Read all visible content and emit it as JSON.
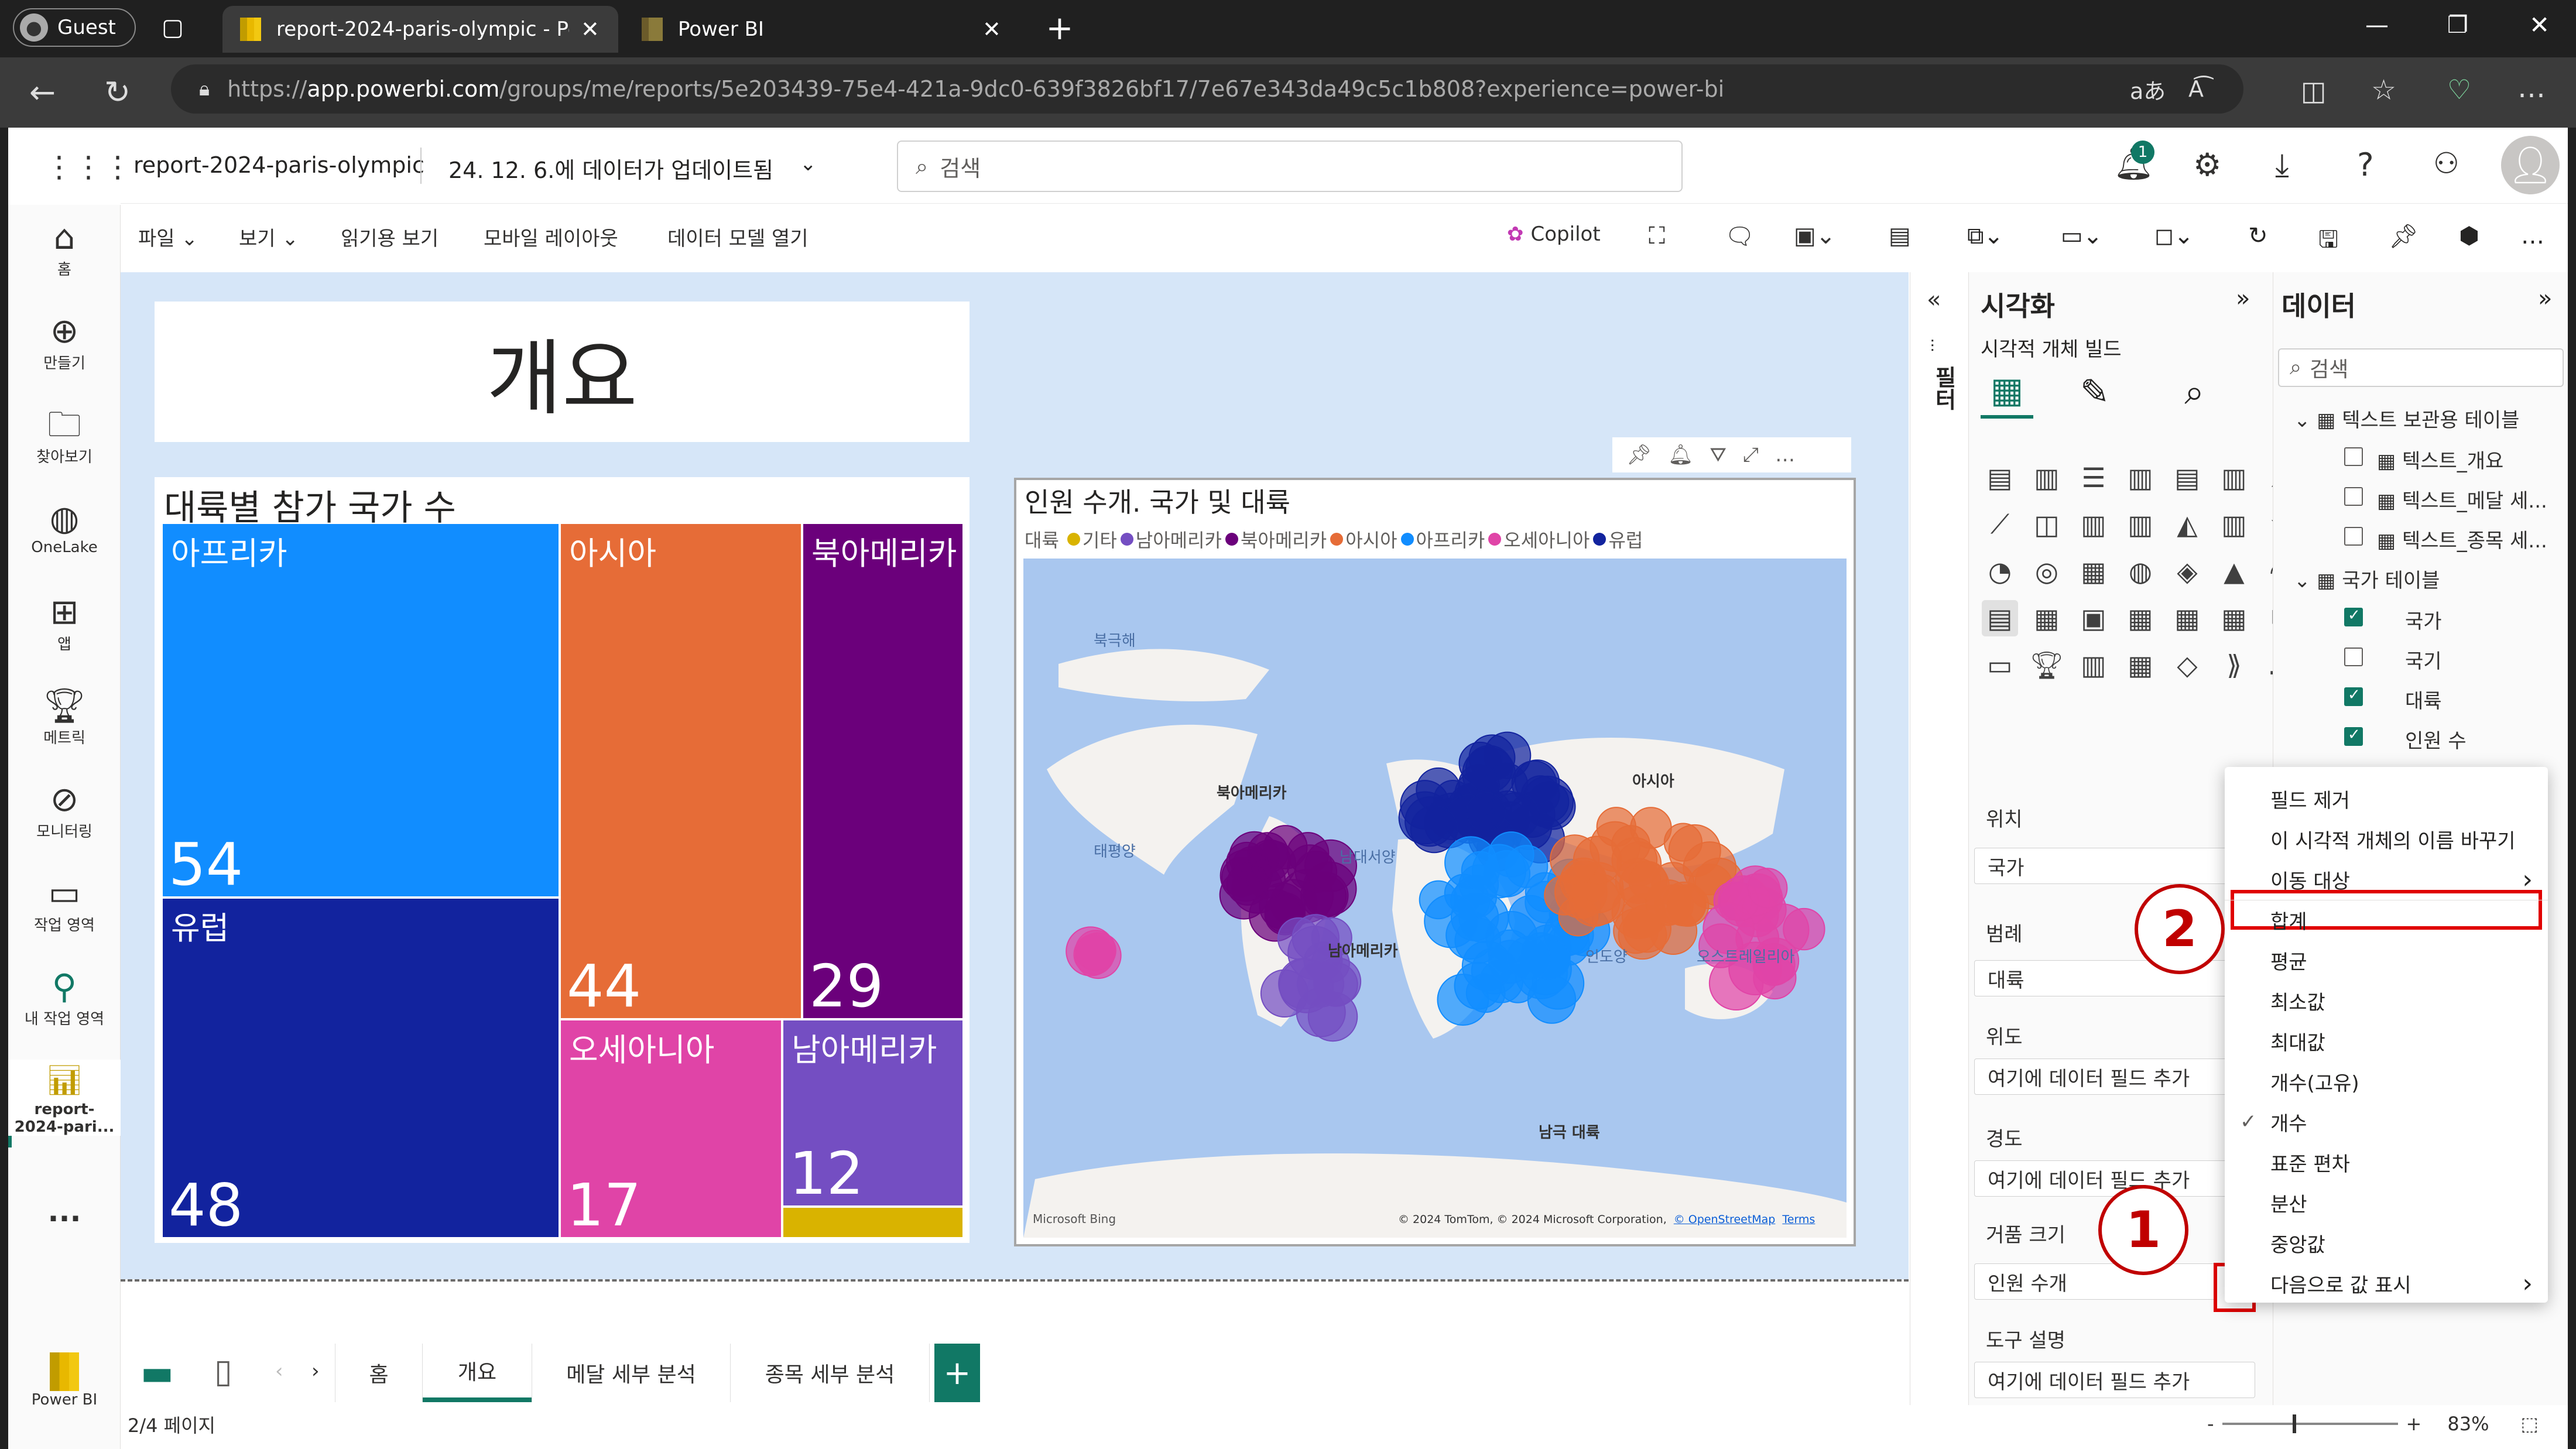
{
  "browser": {
    "profile": "Guest",
    "tabs": [
      {
        "title": "report-2024-paris-olympic - Powe"
      },
      {
        "title": "Power BI"
      }
    ],
    "url_prefix": "https://",
    "url_host": "app.powerbi.com",
    "url_path": "/groups/me/reports/5e203439-75e4-421a-9dc0-639f3826bf17/7e67e343da49c5c1b808?experience=power-bi"
  },
  "header": {
    "report_name": "report-2024-paris-olympic",
    "updated": "24. 12. 6.에 데이터가 업데이트됨",
    "search_placeholder": "검색",
    "notification_count": "1"
  },
  "leftnav": [
    {
      "label": "홈",
      "icon": "home-icon"
    },
    {
      "label": "만들기",
      "icon": "create-icon"
    },
    {
      "label": "찾아보기",
      "icon": "browse-icon"
    },
    {
      "label": "OneLake",
      "icon": "onelake-icon"
    },
    {
      "label": "앱",
      "icon": "apps-icon"
    },
    {
      "label": "메트릭",
      "icon": "metrics-icon"
    },
    {
      "label": "모니터링",
      "icon": "monitor-icon"
    },
    {
      "label": "작업 영역",
      "icon": "workspaces-icon"
    },
    {
      "label": "내 작업 영역",
      "icon": "my-workspace-icon"
    },
    {
      "label1": "report-",
      "label2": "2024-pari...",
      "icon": "report-icon"
    }
  ],
  "leftnav_more": "...",
  "brand": "Power BI",
  "menubar": {
    "file": "파일",
    "view": "보기",
    "reading_view": "읽기용 보기",
    "mobile_layout": "모바일 레이아웃",
    "open_model": "데이터 모델 열기",
    "copilot": "Copilot"
  },
  "canvas": {
    "title_card": "개요",
    "treemap": {
      "title": "대륙별 참가 국가 수",
      "items": [
        {
          "name": "아프리카",
          "value": "54",
          "color": "#118DFF"
        },
        {
          "name": "유럽",
          "value": "48",
          "color": "#12239E"
        },
        {
          "name": "아시아",
          "value": "44",
          "color": "#E66C37"
        },
        {
          "name": "북아메리카",
          "value": "29",
          "color": "#6B007B"
        },
        {
          "name": "오세아니아",
          "value": "17",
          "color": "#E044A7"
        },
        {
          "name": "남아메리카",
          "value": "12",
          "color": "#744EC2"
        },
        {
          "name": "기타",
          "value": "",
          "color": "#D9B300"
        }
      ]
    },
    "map": {
      "title": "인원 수개. 국가 및 대륙",
      "legend_title": "대륙",
      "legend": [
        {
          "name": "기타",
          "color": "#D9B300"
        },
        {
          "name": "남아메리카",
          "color": "#744EC2"
        },
        {
          "name": "북아메리카",
          "color": "#6B007B"
        },
        {
          "name": "아시아",
          "color": "#E66C37"
        },
        {
          "name": "아프리카",
          "color": "#118DFF"
        },
        {
          "name": "오세아니아",
          "color": "#E044A7"
        },
        {
          "name": "유럽",
          "color": "#12239E"
        }
      ],
      "labels": {
        "arctic": "북극해",
        "north_america": "북아메리카",
        "pacific": "태평양",
        "atlantic": "남대서양",
        "south_america": "남아메리카",
        "asia": "아시아",
        "indian": "인도양",
        "oceania": "오스트레일리아",
        "antarctica": "남극 대륙"
      },
      "bing": "Microsoft Bing",
      "copyright": "© 2024 TomTom, © 2024 Microsoft Corporation,",
      "osm": "© OpenStreetMap",
      "terms": "Terms"
    }
  },
  "pages": {
    "tabs": [
      "홈",
      "개요",
      "메달 세부 분석",
      "종목 세부 분석"
    ],
    "active": "개요",
    "counter": "2/4 페이지",
    "zoom": "83%",
    "add": "+"
  },
  "filters_label": "필터",
  "viz": {
    "title": "시각화",
    "subtitle": "시각적 개체 빌드",
    "wells": [
      {
        "label": "위치",
        "value": "국가"
      },
      {
        "label": "범례",
        "value": "대륙"
      },
      {
        "label": "위도",
        "value": "여기에 데이터 필드 추가"
      },
      {
        "label": "경도",
        "value": "여기에 데이터 필드 추가"
      },
      {
        "label": "거품 크기",
        "value": "인원 수개"
      },
      {
        "label": "도구 설명",
        "value": "여기에 데이터 필드 추가"
      }
    ]
  },
  "data": {
    "title": "데이터",
    "search_placeholder": "검색",
    "tables": [
      {
        "name": "텍스트 보관용 테이블",
        "fields": [
          {
            "name": "텍스트_개요",
            "checked": false
          },
          {
            "name": "텍스트_메달 세...",
            "checked": false
          },
          {
            "name": "텍스트_종목 세...",
            "checked": false
          }
        ]
      },
      {
        "name": "국가 테이블",
        "fields": [
          {
            "name": "국가",
            "checked": true
          },
          {
            "name": "국기",
            "checked": false
          },
          {
            "name": "대륙",
            "checked": true
          },
          {
            "name": "인원 수",
            "checked": true
          }
        ]
      }
    ]
  },
  "context_menu": {
    "items": [
      "필드 제거",
      "이 시각적 개체의 이름 바꾸기",
      "이동 대상",
      "합계",
      "평균",
      "최소값",
      "최대값",
      "개수(고유)",
      "개수",
      "표준 편차",
      "분산",
      "중앙값",
      "다음으로 값 표시"
    ],
    "checked": "개수",
    "highlighted": "합계"
  },
  "annotations": [
    "1",
    "2"
  ]
}
